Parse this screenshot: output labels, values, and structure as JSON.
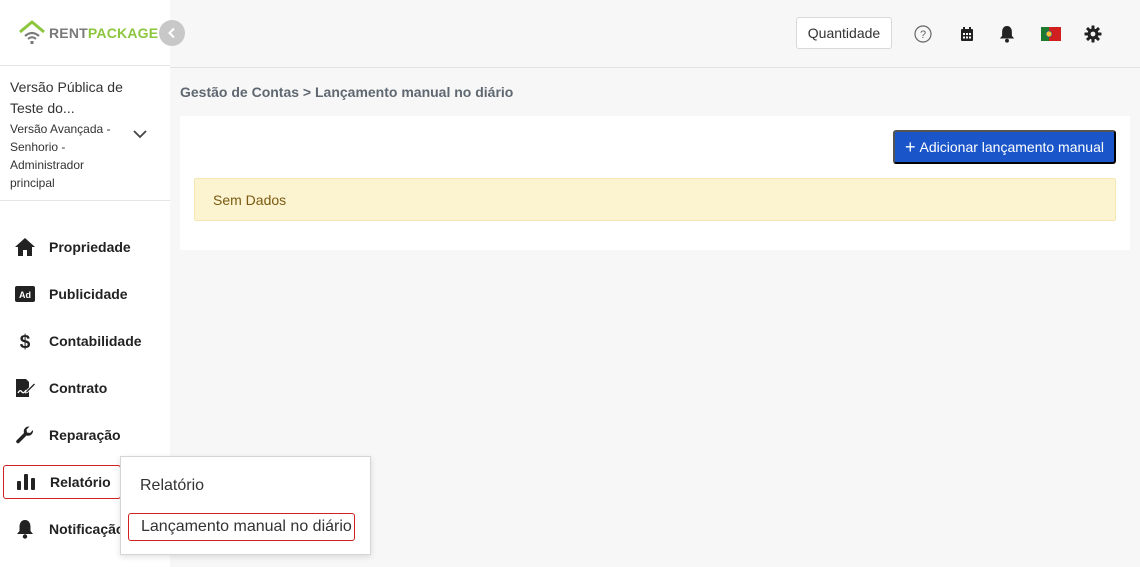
{
  "brand": {
    "part1": "RENT",
    "part2": "PACKAGE",
    "green": "#8cc63f",
    "gray": "#7a7a7a"
  },
  "account": {
    "name": "Versão Pública de Teste do...",
    "role": "Versão Avançada - Senhorio - Administrador principal"
  },
  "sidebar": {
    "items": [
      {
        "label": "Propriedade",
        "icon": "home-icon"
      },
      {
        "label": "Publicidade",
        "icon": "ad-icon"
      },
      {
        "label": "Contabilidade",
        "icon": "dollar-icon"
      },
      {
        "label": "Contrato",
        "icon": "contract-icon"
      },
      {
        "label": "Reparação",
        "icon": "wrench-icon"
      },
      {
        "label": "Relatório",
        "icon": "bar-chart-icon",
        "active": true
      },
      {
        "label": "Notificação",
        "icon": "bell-icon"
      }
    ]
  },
  "topbar": {
    "quantity_label": "Quantidade",
    "icons": [
      "help-icon",
      "calendar-icon",
      "bell-icon",
      "portugal-flag-icon",
      "gear-icon"
    ]
  },
  "breadcrumb": "Gestão de Contas > Lançamento manual no diário",
  "main": {
    "add_button_label": "Adicionar lançamento manual",
    "empty_message": "Sem Dados"
  },
  "submenu": {
    "items": [
      "Relatório",
      "Lançamento manual no diário"
    ]
  },
  "colors": {
    "primary": "#1a56c9",
    "highlight": "#d21f1f",
    "empty_bg": "#fcf3d1"
  }
}
